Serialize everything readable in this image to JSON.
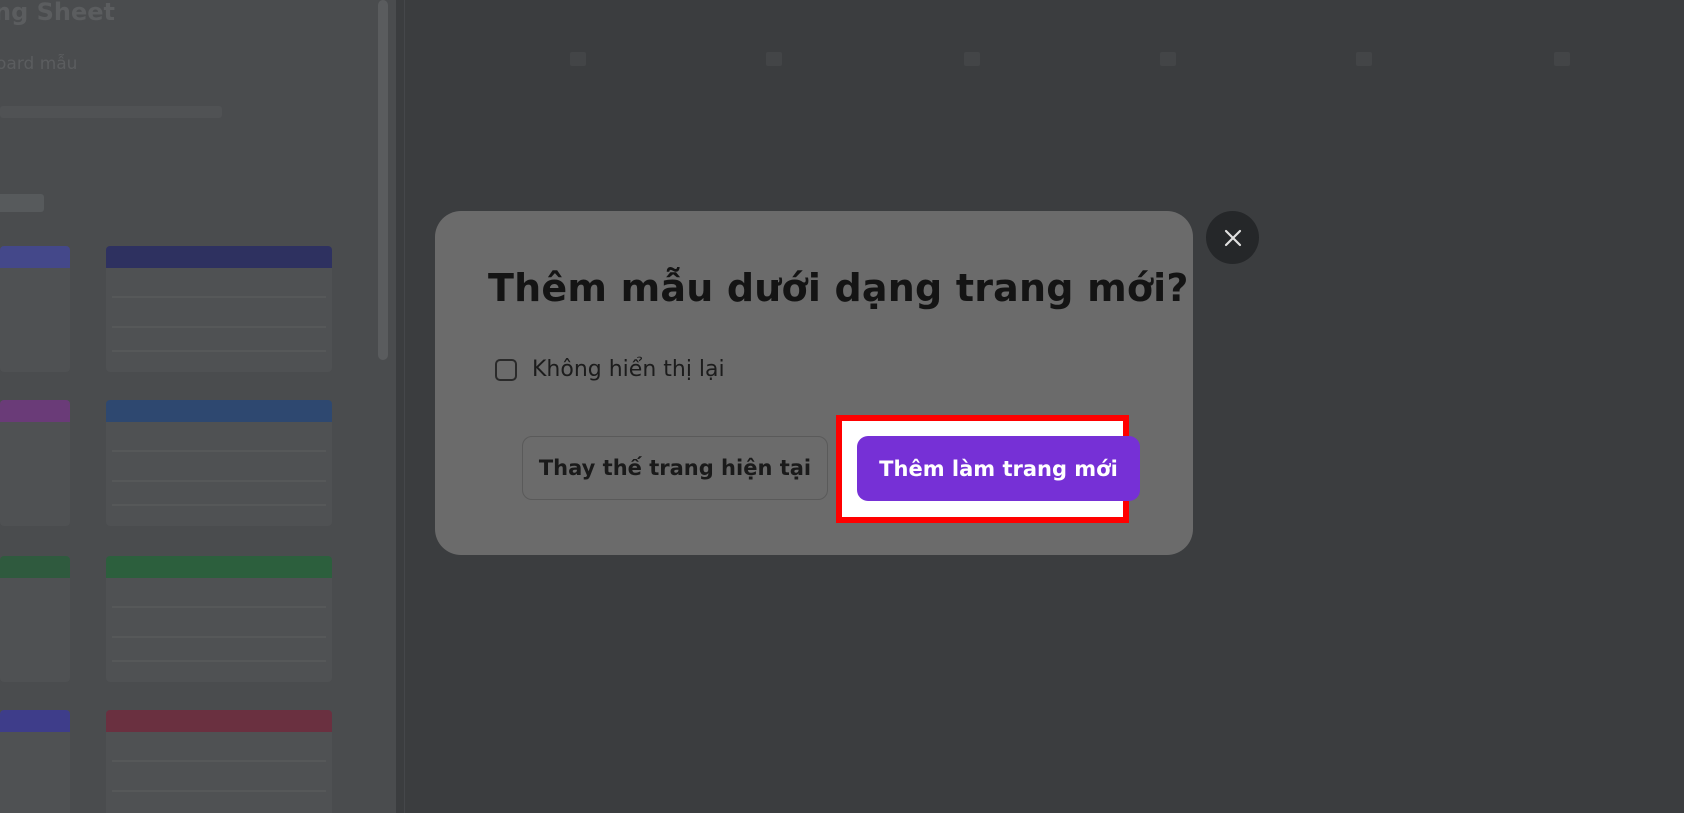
{
  "background": {
    "sidebar_title": "ng Sheet",
    "sidebar_subtitle": "oard mẫu"
  },
  "modal": {
    "title": "Thêm mẫu dưới dạng trang mới?",
    "checkbox_label": "Không hiển thị lại",
    "checkbox_checked": false,
    "secondary_button": "Thay thế trang hiện tại",
    "primary_button": "Thêm làm trang mới",
    "close_icon": "close-icon"
  },
  "colors": {
    "primary": "#7630d6",
    "highlight": "#ff0000"
  }
}
